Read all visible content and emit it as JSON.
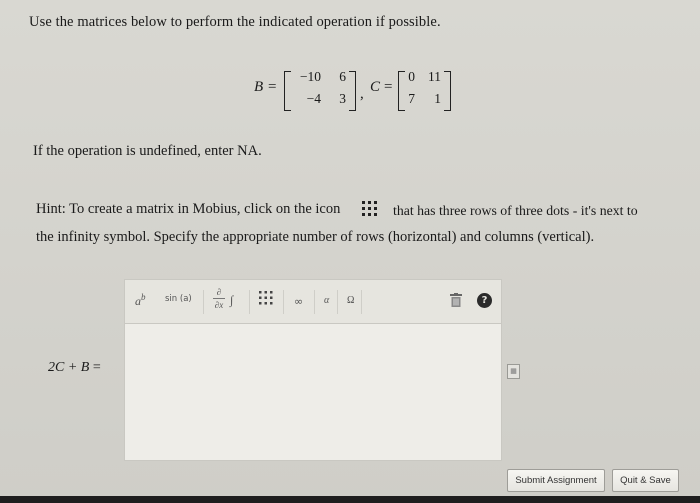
{
  "question": {
    "prompt": "Use the matrices below to perform the indicated operation if possible.",
    "matrices": {
      "b_label": "B",
      "c_label": "C",
      "equals": "=",
      "comma": ",",
      "B": [
        [
          "−10",
          "6"
        ],
        [
          "−4",
          "3"
        ]
      ],
      "C": [
        [
          "0",
          "11"
        ],
        [
          "7",
          "1"
        ]
      ]
    },
    "undefined_note": "If the operation is undefined, enter NA.",
    "hint_part1": "Hint: To create a matrix in Mobius, click on the icon",
    "hint_part2": "that has three rows of three dots - it's next to",
    "hint_line2": "the infinity symbol. Specify the appropriate number of rows (horizontal) and columns (vertical)."
  },
  "icons": {
    "matrix_dots": "matrix-dots-icon"
  },
  "editor": {
    "toolbar": {
      "power": "a",
      "power_sup": "b",
      "sin": "sin (a)",
      "deriv_top": "∂",
      "deriv_bottom": "∂x",
      "integral": "∫",
      "infinity": "∞",
      "alpha": "α",
      "omega": "Ω",
      "help": "?"
    },
    "expression_label_left": "2C + B",
    "expression_label_eq": "="
  },
  "buttons": {
    "submit": "Submit Assignment",
    "quit": "Quit & Save"
  }
}
